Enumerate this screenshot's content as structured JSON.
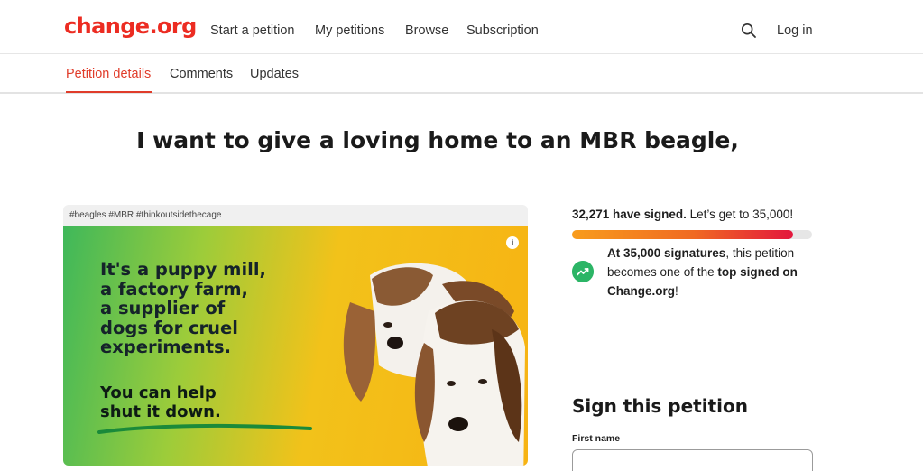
{
  "header": {
    "logo": "change.org",
    "nav": [
      "Start a petition",
      "My petitions",
      "Browse",
      "Subscription"
    ],
    "login": "Log in",
    "search_icon": "search-icon"
  },
  "tabs": {
    "items": [
      "Petition details",
      "Comments",
      "Updates"
    ],
    "active": "Petition details"
  },
  "petition": {
    "title": "I want to give a loving home to an MBR beagle,"
  },
  "media": {
    "hashtags": "#beagles #MBR #thinkoutsidethecage",
    "poster_lines": [
      "It's a puppy mill,",
      "a factory farm,",
      "a supplier of",
      "dogs for cruel",
      "experiments."
    ],
    "poster_cta_lines": [
      "You can help",
      "shut it down."
    ],
    "info_icon": "i"
  },
  "signatures": {
    "count_text": "32,271 have signed.",
    "goal_text": "Let’s get to 35,000!",
    "progress": 0.92,
    "milestone_bold_1": "At 35,000 signatures",
    "milestone_text_1": ", this petition becomes one of the ",
    "milestone_bold_2": "top signed on Change.org",
    "milestone_text_2": "!"
  },
  "sign_form": {
    "heading": "Sign this petition",
    "first_name_label": "First name",
    "first_name_value": ""
  },
  "colors": {
    "brand": "#ec2c22",
    "tab_active": "#e03c2a",
    "trend_icon": "#2cb566"
  }
}
